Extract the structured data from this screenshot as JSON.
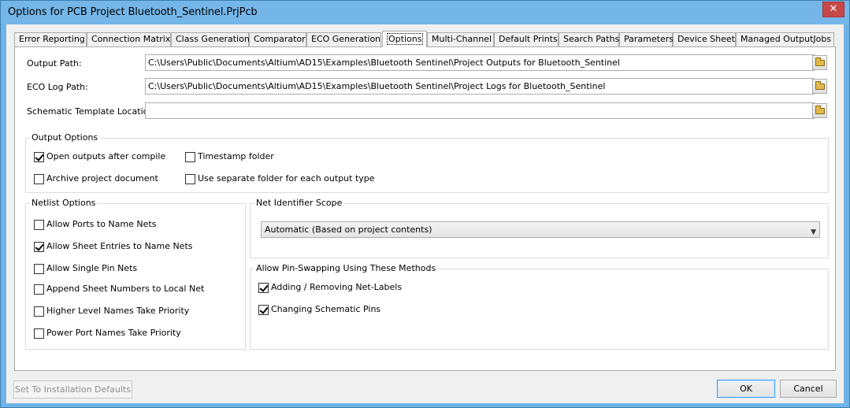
{
  "window": {
    "title": "Options for PCB Project Bluetooth_Sentinel.PrjPcb",
    "close_glyph": "✕"
  },
  "tabs": [
    {
      "label": "Error Reporting"
    },
    {
      "label": "Connection Matrix"
    },
    {
      "label": "Class Generation"
    },
    {
      "label": "Comparator"
    },
    {
      "label": "ECO Generation"
    },
    {
      "label": "Options",
      "active": true
    },
    {
      "label": "Multi-Channel"
    },
    {
      "label": "Default Prints"
    },
    {
      "label": "Search Paths"
    },
    {
      "label": "Parameters"
    },
    {
      "label": "Device Sheets"
    },
    {
      "label": "Managed OutputJobs"
    }
  ],
  "paths": {
    "output_label": "Output Path:",
    "output_value": "C:\\Users\\Public\\Documents\\Altium\\AD15\\Examples\\Bluetooth Sentinel\\Project Outputs for Bluetooth_Sentinel",
    "eco_label": "ECO Log Path:",
    "eco_value": "C:\\Users\\Public\\Documents\\Altium\\AD15\\Examples\\Bluetooth Sentinel\\Project Logs for Bluetooth_Sentinel",
    "template_label": "Schematic Template Location:",
    "template_value": ""
  },
  "output_options": {
    "title": "Output Options",
    "open_outputs": {
      "label": "Open outputs after compile",
      "checked": true
    },
    "timestamp_folder": {
      "label": "Timestamp folder",
      "checked": false
    },
    "archive_project": {
      "label": "Archive project document",
      "checked": false
    },
    "separate_folder": {
      "label": "Use separate folder for each output type",
      "checked": false
    }
  },
  "netlist_options": {
    "title": "Netlist Options",
    "items": [
      {
        "label": "Allow Ports to Name Nets",
        "checked": false
      },
      {
        "label": "Allow Sheet Entries to Name Nets",
        "checked": true
      },
      {
        "label": "Allow Single Pin Nets",
        "checked": false
      },
      {
        "label": "Append Sheet Numbers to Local Net",
        "checked": false
      },
      {
        "label": "Higher Level Names Take Priority",
        "checked": false
      },
      {
        "label": "Power Port Names Take Priority",
        "checked": false
      }
    ]
  },
  "net_identifier": {
    "title": "Net Identifier Scope",
    "selected": "Automatic (Based on project contents)"
  },
  "pin_swapping": {
    "title": "Allow Pin-Swapping Using These Methods",
    "items": [
      {
        "label": "Adding / Removing Net-Labels",
        "checked": true
      },
      {
        "label": "Changing Schematic Pins",
        "checked": true
      }
    ]
  },
  "buttons": {
    "defaults": "Set To Installation Defaults",
    "ok": "OK",
    "cancel": "Cancel"
  },
  "icons": {
    "browse": "folder-icon",
    "dropdown": "chevron-down-icon",
    "close": "close-icon"
  }
}
